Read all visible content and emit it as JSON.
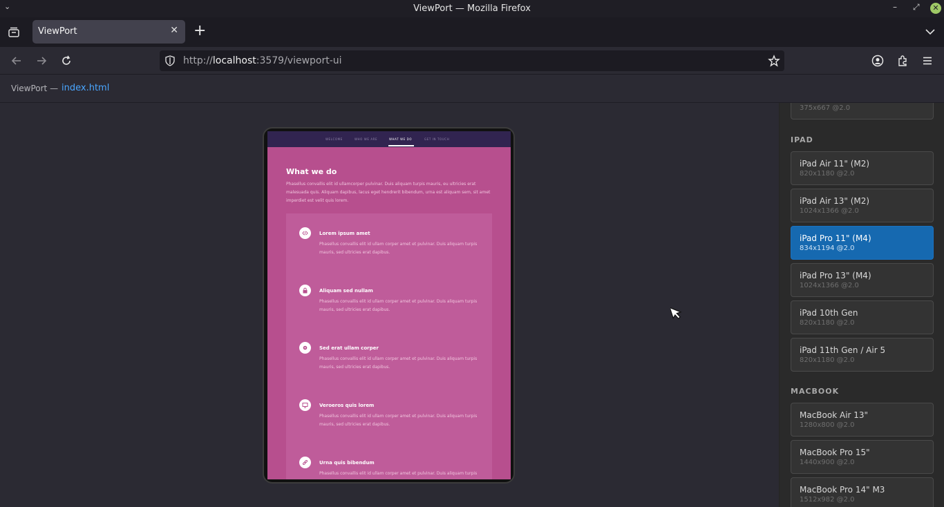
{
  "window": {
    "title": "ViewPort — Mozilla Firefox"
  },
  "tabs": [
    {
      "label": "ViewPort"
    }
  ],
  "urlbar": {
    "url_prefix": "http://",
    "url_host": "localhost",
    "url_rest": ":3579/viewport-ui"
  },
  "app_header": {
    "brand": "ViewPort —",
    "file": "index.html"
  },
  "site": {
    "nav": [
      "WELCOME",
      "WHO WE ARE",
      "WHAT WE DO",
      "GET IN TOUCH"
    ],
    "active_nav": "WHAT WE DO",
    "section_title": "What we do",
    "section_desc": "Phasellus convallis elit id ullamcorper pulvinar. Duis aliquam turpis mauris, eu ultricies erat malesuada quis. Aliquam dapibus, lacus eget hendrerit bibendum, urna est aliquam sem, sit amet imperdiet est velit quis lorem.",
    "features": [
      {
        "title": "Lorem ipsum amet",
        "text": "Phasellus convallis elit id ullam corper amet et pulvinar. Duis aliquam turpis mauris, sed ultricies erat dapibus.",
        "icon": "code-icon"
      },
      {
        "title": "Aliquam sed nullam",
        "text": "Phasellus convallis elit id ullam corper amet et pulvinar. Duis aliquam turpis mauris, sed ultricies erat dapibus.",
        "icon": "lock-icon"
      },
      {
        "title": "Sed erat ullam corper",
        "text": "Phasellus convallis elit id ullam corper amet et pulvinar. Duis aliquam turpis mauris, sed ultricies erat dapibus.",
        "icon": "gear-icon"
      },
      {
        "title": "Veroeros quis lorem",
        "text": "Phasellus convallis elit id ullam corper amet et pulvinar. Duis aliquam turpis mauris, sed ultricies erat dapibus.",
        "icon": "desktop-icon"
      },
      {
        "title": "Urna quis bibendum",
        "text": "Phasellus convallis elit id ullam corper amet et pulvinar. Duis aliquam turpis",
        "icon": "link-icon"
      }
    ]
  },
  "sidebar": {
    "partial_top_card": {
      "res": "375x667 @2.0"
    },
    "groups": [
      {
        "label": "IPAD",
        "devices": [
          {
            "name": "iPad Air 11\" (M2)",
            "res": "820x1180 @2.0"
          },
          {
            "name": "iPad Air 13\" (M2)",
            "res": "1024x1366 @2.0"
          },
          {
            "name": "iPad Pro 11\" (M4)",
            "res": "834x1194 @2.0",
            "selected": true
          },
          {
            "name": "iPad Pro 13\" (M4)",
            "res": "1024x1366 @2.0"
          },
          {
            "name": "iPad 10th Gen",
            "res": "820x1180 @2.0"
          },
          {
            "name": "iPad 11th Gen / Air 5",
            "res": "820x1180 @2.0"
          }
        ]
      },
      {
        "label": "MACBOOK",
        "devices": [
          {
            "name": "MacBook Air 13\"",
            "res": "1280x800 @2.0"
          },
          {
            "name": "MacBook Pro 15\"",
            "res": "1440x900 @2.0"
          },
          {
            "name": "MacBook Pro 14\" M3",
            "res": "1512x982 @2.0"
          }
        ]
      }
    ]
  },
  "colors": {
    "accent": "#1669b0",
    "site_bg": "#b74f8e",
    "site_nav": "#312450"
  }
}
